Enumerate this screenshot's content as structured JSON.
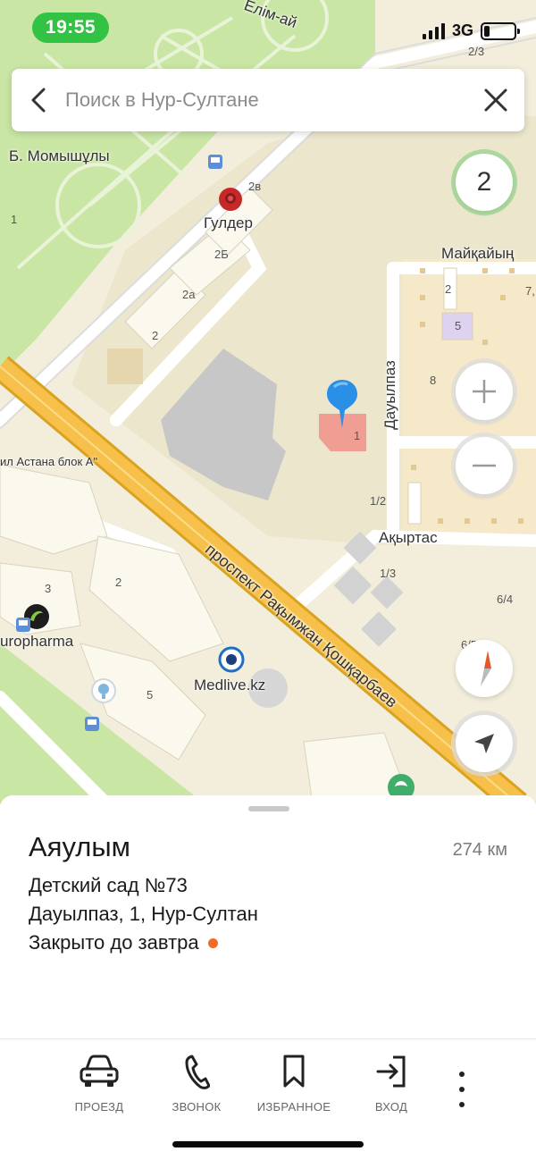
{
  "status_bar": {
    "time": "19:55",
    "network": "3G"
  },
  "search": {
    "placeholder": "Поиск в Нур-Султане",
    "value": ""
  },
  "map": {
    "traffic_level": "2",
    "street_labels": {
      "elim_ai": "Елім-ай",
      "momyshuly": "Б. Момышұлы",
      "maikaiyn": "Майқайың",
      "dauylpaz": "Дауылпаз",
      "akyrtas": "Ақыртас",
      "avenue": "проспект Рақымжан Қошқарбаев",
      "astana_block": "ил Астана блок А\""
    },
    "poi_labels": {
      "gulder": "Гулдер",
      "europharma": "uropharma",
      "medlive": "Medlive.kz"
    },
    "house_numbers": {
      "n_2_3": "2/3",
      "n_2v": "2в",
      "n_2b": "2Б",
      "n_2a": "2а",
      "n_2_left": "2",
      "n_1_park": "1",
      "n_2_maik": "2",
      "n_7": "7,",
      "n_5_maik": "5",
      "n_8": "8",
      "n_1_kg": "1",
      "n_1_2": "1/2",
      "n_1_3": "1/3",
      "n_6_4": "6/4",
      "n_6_5": "6/5",
      "n_3": "3",
      "n_2_block": "2",
      "n_5_block": "5"
    },
    "colors": {
      "road_main": "#f7b731",
      "park": "#c9e6a5",
      "land": "#f2eedb",
      "pin": "#2a8fe6"
    }
  },
  "place": {
    "name": "Аяулым",
    "distance": "274 км",
    "category": "Детский сад №73",
    "address": "Дауылпаз, 1, Нур-Султан",
    "hours_status": "Закрыто до завтра",
    "status_color": "#f06b28"
  },
  "actions": [
    {
      "label": "ПРОЕЗД",
      "icon": "car-icon"
    },
    {
      "label": "ЗВОНОК",
      "icon": "phone-icon"
    },
    {
      "label": "ИЗБРАННОЕ",
      "icon": "bookmark-icon"
    },
    {
      "label": "ВХОД",
      "icon": "entrance-icon"
    }
  ]
}
